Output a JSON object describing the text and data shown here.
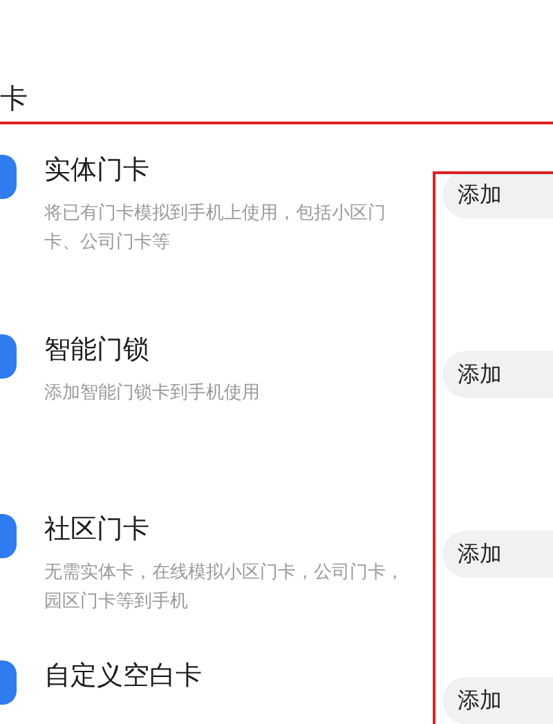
{
  "section": {
    "title": "卡"
  },
  "cards": [
    {
      "title": "实体门卡",
      "description": "将已有门卡模拟到手机上使用，包括小区门卡、公司门卡等",
      "button": "添加"
    },
    {
      "title": "智能门锁",
      "description": "添加智能门锁卡到手机使用",
      "button": "添加"
    },
    {
      "title": "社区门卡",
      "description": "无需实体卡，在线模拟小区门卡，公司门卡，园区门卡等到手机",
      "button": "添加"
    },
    {
      "title": "自定义空白卡",
      "button": "添加"
    }
  ]
}
